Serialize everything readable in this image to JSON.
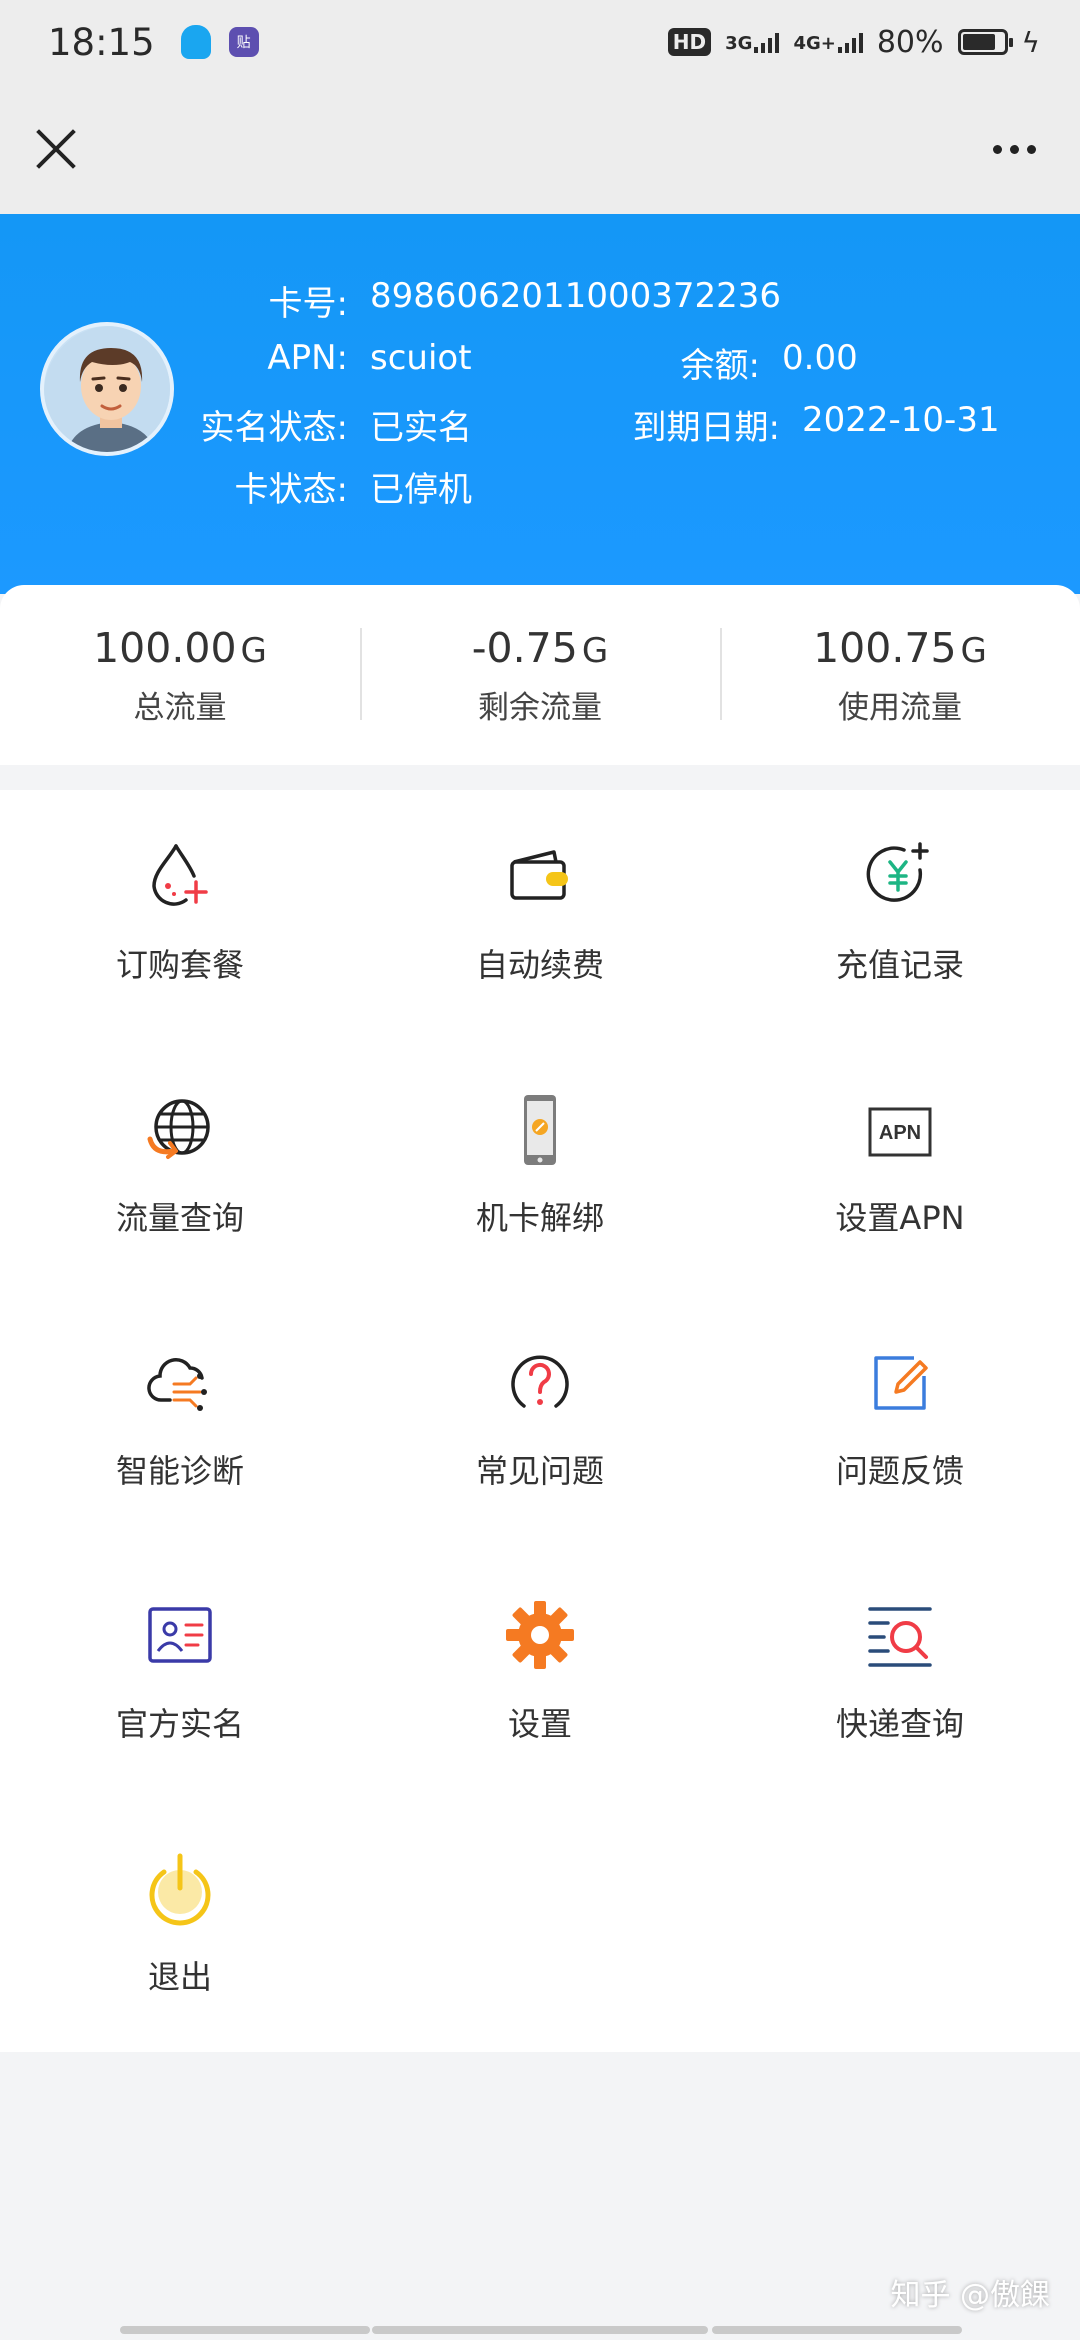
{
  "status_bar": {
    "time": "18:15",
    "network_hd": "HD",
    "network_3g": "3G",
    "network_4g": "4G+",
    "battery": "80%",
    "battery_level": 0.8
  },
  "card": {
    "card_no_label": "卡号:",
    "card_no": "8986062011000372236",
    "apn_label": "APN:",
    "apn": "scuiot",
    "balance_label": "余额:",
    "balance": "0.00",
    "realname_label": "实名状态:",
    "realname": "已实名",
    "expire_label": "到期日期:",
    "expire": "2022-10-31",
    "status_label": "卡状态:",
    "status": "已停机"
  },
  "stats": [
    {
      "value": "100.00",
      "unit": "G",
      "label": "总流量"
    },
    {
      "value": "-0.75",
      "unit": "G",
      "label": "剩余流量"
    },
    {
      "value": "100.75",
      "unit": "G",
      "label": "使用流量"
    }
  ],
  "menu": [
    {
      "label": "订购套餐",
      "icon": "drop-plus-icon"
    },
    {
      "label": "自动续费",
      "icon": "wallet-icon"
    },
    {
      "label": "充值记录",
      "icon": "yuan-plus-icon"
    },
    {
      "label": "流量查询",
      "icon": "globe-icon"
    },
    {
      "label": "机卡解绑",
      "icon": "phone-icon"
    },
    {
      "label": "设置APN",
      "icon": "apn-icon"
    },
    {
      "label": "智能诊断",
      "icon": "cloud-icon"
    },
    {
      "label": "常见问题",
      "icon": "question-icon"
    },
    {
      "label": "问题反馈",
      "icon": "edit-icon"
    },
    {
      "label": "官方实名",
      "icon": "id-card-icon"
    },
    {
      "label": "设置",
      "icon": "gear-icon"
    },
    {
      "label": "快递查询",
      "icon": "search-list-icon"
    },
    {
      "label": "退出",
      "icon": "power-icon"
    }
  ],
  "apn_icon_text": "APN",
  "watermark": "知乎 @傲餜",
  "colors": {
    "header_blue": "#1c99ff",
    "accent_red": "#f03c46",
    "accent_orange": "#f57a22",
    "accent_yellow": "#f5c518"
  }
}
